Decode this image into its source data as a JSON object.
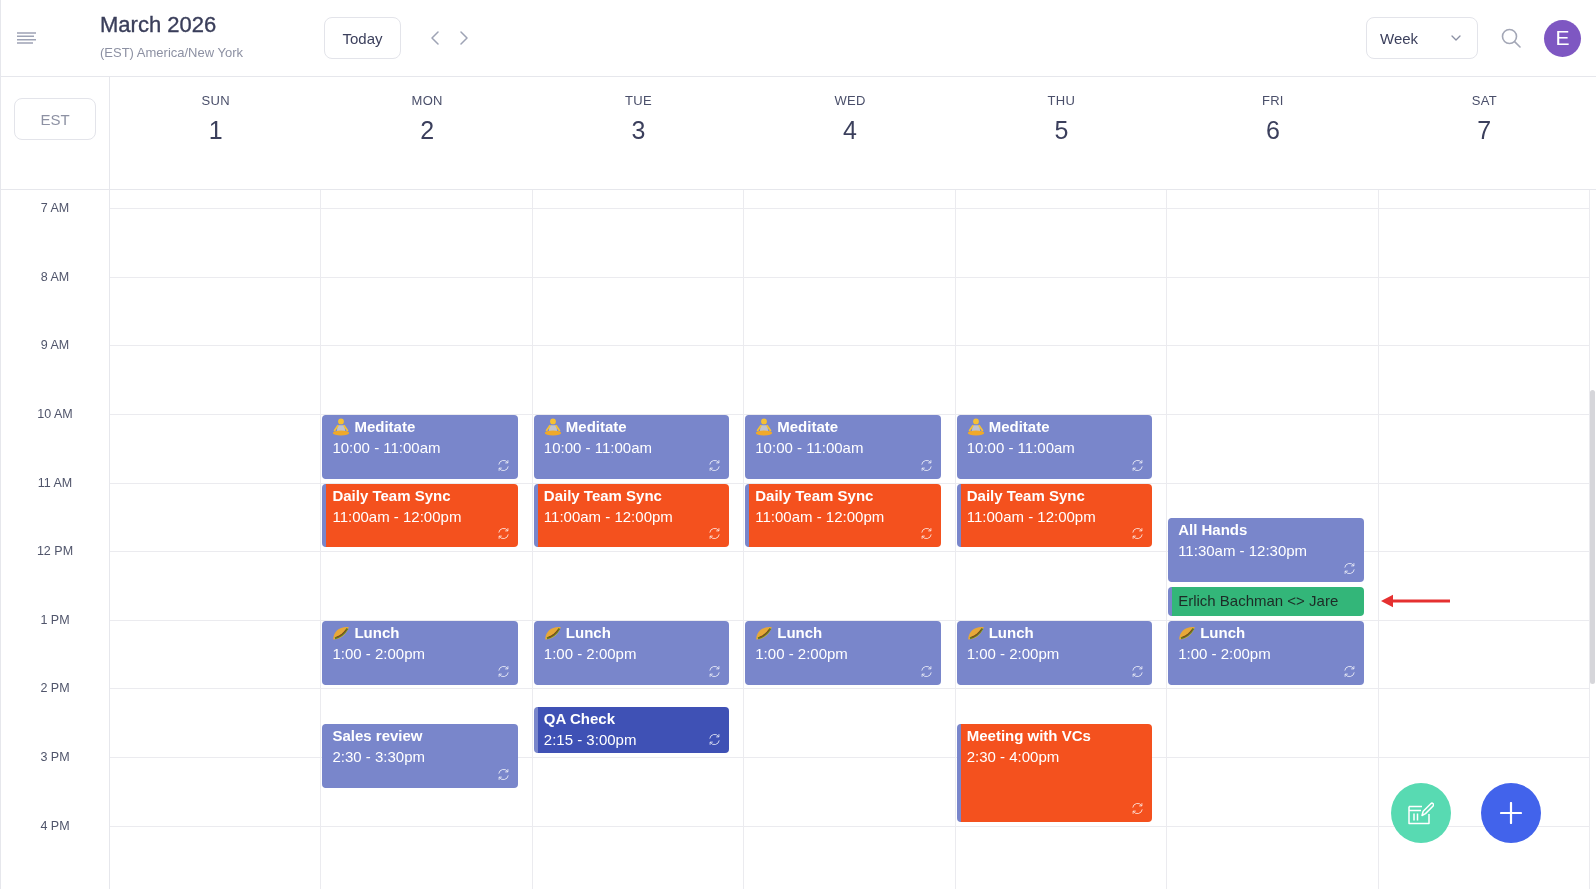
{
  "header": {
    "title": "March 2026",
    "timezone": "(EST) America/New York",
    "today_button": "Today",
    "view_select": {
      "value": "Week"
    },
    "avatar": {
      "initial": "E"
    }
  },
  "week": {
    "timezone_button": "EST",
    "days": [
      {
        "name": "SUN",
        "date": "1"
      },
      {
        "name": "MON",
        "date": "2",
        "events": [
          {
            "kind": "meditation",
            "title": "Meditate",
            "time": "10:00 - 11:00am",
            "color": "#7986cb",
            "recurring": true,
            "highlighted": false
          },
          {
            "kind": "event",
            "title": "Daily Team Sync",
            "time": "11:00am - 12:00pm",
            "color": "#f4511e",
            "recurring": true,
            "highlighted": false
          },
          {
            "kind": "meal",
            "title": "Lunch",
            "time": "1:00 - 2:00pm",
            "color": "#7986cb",
            "recurring": true,
            "highlighted": false
          },
          {
            "kind": "event",
            "title": "Sales review",
            "time": "2:30 - 3:30pm",
            "color": "#7986cb",
            "recurring": true,
            "highlighted": false
          }
        ]
      },
      {
        "name": "TUE",
        "date": "3",
        "events": [
          {
            "kind": "meditation",
            "title": "Meditate",
            "time": "10:00 - 11:00am",
            "color": "#7986cb",
            "recurring": true,
            "highlighted": false
          },
          {
            "kind": "event",
            "title": "Daily Team Sync",
            "time": "11:00am - 12:00pm",
            "color": "#f4511e",
            "recurring": true,
            "highlighted": false
          },
          {
            "kind": "meal",
            "title": "Lunch",
            "time": "1:00 - 2:00pm",
            "color": "#7986cb",
            "recurring": true,
            "highlighted": false
          },
          {
            "kind": "event",
            "title": "QA Check",
            "time": "2:15 - 3:00pm",
            "color": "#3f51b5",
            "recurring": true,
            "highlighted": false
          }
        ]
      },
      {
        "name": "WED",
        "date": "4",
        "events": [
          {
            "kind": "meditation",
            "title": "Meditate",
            "time": "10:00 - 11:00am",
            "color": "#7986cb",
            "recurring": true,
            "highlighted": false
          },
          {
            "kind": "event",
            "title": "Daily Team Sync",
            "time": "11:00am - 12:00pm",
            "color": "#f4511e",
            "recurring": true,
            "highlighted": false
          },
          {
            "kind": "meal",
            "title": "Lunch",
            "time": "1:00 - 2:00pm",
            "color": "#7986cb",
            "recurring": true,
            "highlighted": false
          }
        ]
      },
      {
        "name": "THU",
        "date": "5",
        "events": [
          {
            "kind": "meditation",
            "title": "Meditate",
            "time": "10:00 - 11:00am",
            "color": "#7986cb",
            "recurring": true,
            "highlighted": false
          },
          {
            "kind": "event",
            "title": "Daily Team Sync",
            "time": "11:00am - 12:00pm",
            "color": "#f4511e",
            "recurring": true,
            "highlighted": false
          },
          {
            "kind": "meal",
            "title": "Lunch",
            "time": "1:00 - 2:00pm",
            "color": "#7986cb",
            "recurring": true,
            "highlighted": false
          },
          {
            "kind": "event",
            "title": "Meeting with VCs",
            "time": "2:30 - 4:00pm",
            "color": "#f4511e",
            "recurring": true,
            "highlighted": false
          }
        ]
      },
      {
        "name": "FRI",
        "date": "6",
        "events": [
          {
            "kind": "event",
            "title": "All Hands",
            "time": "11:30am - 12:30pm",
            "color": "#7986cb",
            "recurring": true,
            "highlighted": false
          },
          {
            "kind": "compact",
            "title": "Erlich Bachman <> Jare",
            "color": "#33b679",
            "recurring": false,
            "highlighted": true
          },
          {
            "kind": "meal",
            "title": "Lunch",
            "time": "1:00 - 2:00pm",
            "color": "#7986cb",
            "recurring": true,
            "highlighted": false
          }
        ]
      },
      {
        "name": "SAT",
        "date": "7"
      }
    ],
    "hours": [
      "7 AM",
      "8 AM",
      "9 AM",
      "10 AM",
      "11 AM",
      "12 PM",
      "1 PM",
      "2 PM",
      "3 PM",
      "4 PM"
    ]
  }
}
